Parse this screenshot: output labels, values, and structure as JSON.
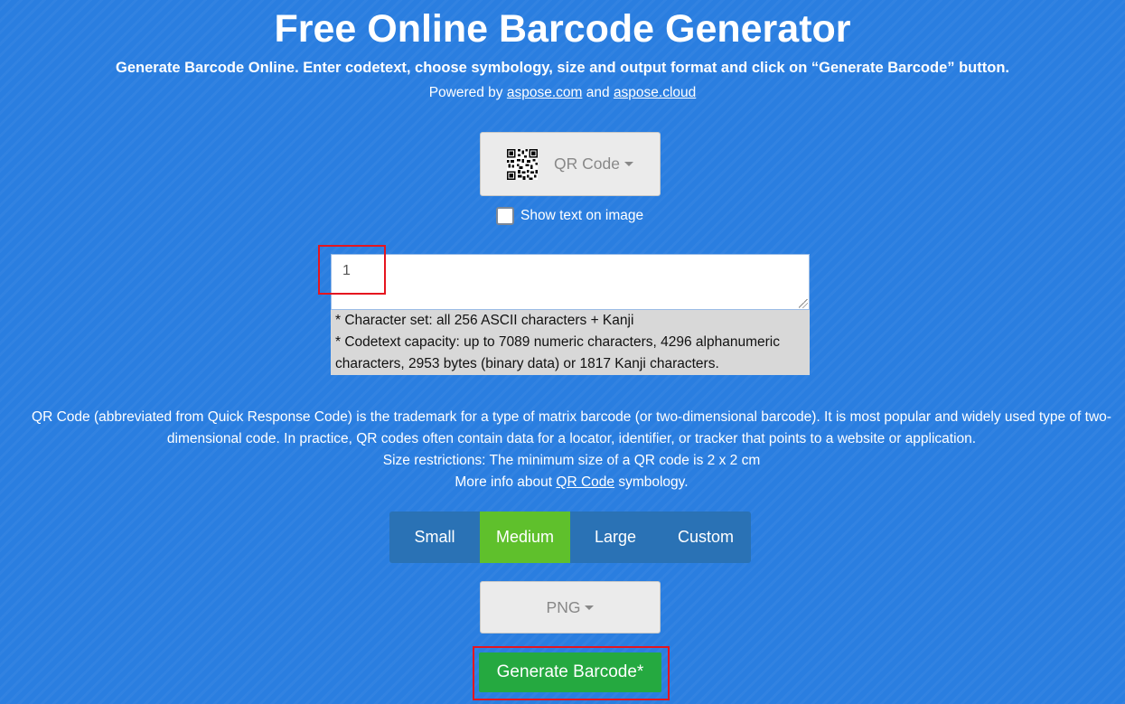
{
  "header": {
    "title": "Free Online Barcode Generator",
    "subtitle": "Generate Barcode Online. Enter codetext, choose symbology, size and output format and click on “Generate Barcode” button.",
    "powered_by": {
      "prefix": "Powered by ",
      "link1": "aspose.com",
      "and": " and ",
      "link2": "aspose.cloud"
    }
  },
  "symbology": {
    "selected": "QR Code",
    "icon": "qr-code-icon"
  },
  "show_text": {
    "label": "Show text on image",
    "checked": false
  },
  "codetext": {
    "value": "1"
  },
  "charset_info": {
    "line1": "* Character set: all 256 ASCII characters + Kanji",
    "line2": "* Codetext capacity: up to 7089 numeric characters, 4296 alphanumeric characters, 2953 bytes (binary data) or 1817 Kanji characters."
  },
  "description": {
    "para": "QR Code (abbreviated from Quick Response Code) is the trademark for a type of matrix barcode (or two-dimensional barcode). It is most popular and widely used type of two-dimensional code. In practice, QR codes often contain data for a locator, identifier, or tracker that points to a website or application.",
    "size_restrictions": "Size restrictions: The minimum size of a QR code is 2 x 2 cm",
    "more_info_prefix": "More info about ",
    "more_info_link": "QR Code",
    "more_info_suffix": " symbology."
  },
  "size_options": [
    "Small",
    "Medium",
    "Large",
    "Custom"
  ],
  "size_selected": "Medium",
  "format": {
    "selected": "PNG"
  },
  "generate_button": "Generate Barcode*",
  "colors": {
    "background": "#2a7ee0",
    "size_active": "#5fc02c",
    "size_inactive": "#2a72b5",
    "generate": "#25a940",
    "highlight": "#e5151f"
  }
}
